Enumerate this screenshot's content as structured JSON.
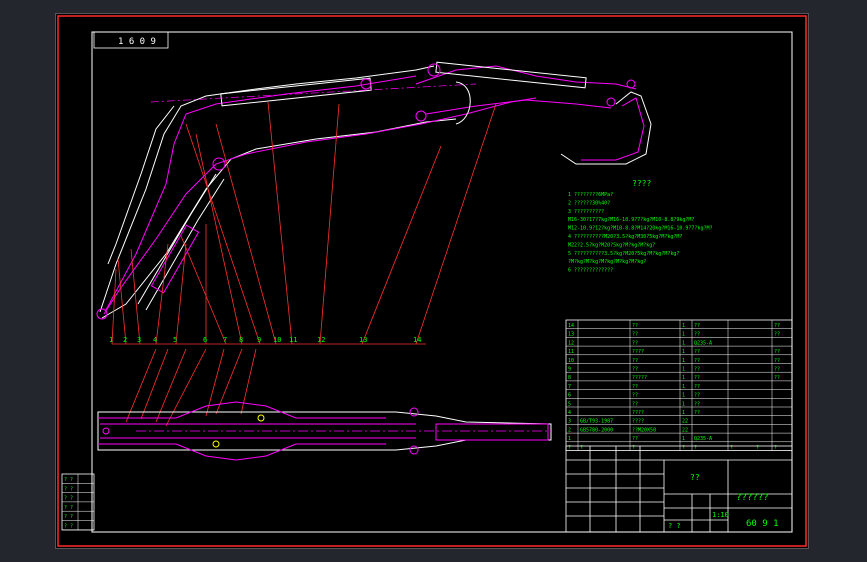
{
  "drawing": {
    "stamp_label": "1 6 0 9",
    "notes_heading": "????",
    "notes": [
      "1    ????????6MPa?",
      "2    ??????30%40?",
      "3    ??????????",
      "     M16-30?17?7kg?M16-10.9?7?kg?M10-8.8?9kg?M?",
      "     M12-10.9?12?kg?M10-8.8?M14?20kg?M16-10.9?7?kg?M?",
      "4    ??????????M20?3.5?kg?M30?5kg?M?kg?M?",
      "     M22?2.5?kg?M20?5kg?M?kg?M?kg?",
      "5    ??????????3.5?kg?M20?5kg?M?kg?M?kg?",
      "     ?M?kg?M?kg?M?kg?M?kg?M?kg?",
      "6    ?????????????"
    ],
    "balloons": [
      "1",
      "2",
      "3",
      "4",
      "5",
      "6",
      "7",
      "8",
      "9",
      "10",
      "11",
      "12",
      "13",
      "14"
    ],
    "bom_rows": [
      {
        "no": "14",
        "code": "",
        "name": "??",
        "qty": "1",
        "mat": "??",
        "note": "??"
      },
      {
        "no": "13",
        "code": "",
        "name": "??",
        "qty": "1",
        "mat": "??",
        "note": "??"
      },
      {
        "no": "12",
        "code": "",
        "name": "??",
        "qty": "1",
        "mat": "Q235-A",
        "note": ""
      },
      {
        "no": "11",
        "code": "",
        "name": "????",
        "qty": "1",
        "mat": "??",
        "note": "??"
      },
      {
        "no": "10",
        "code": "",
        "name": "??",
        "qty": "1",
        "mat": "??",
        "note": "??"
      },
      {
        "no": "9",
        "code": "",
        "name": "??",
        "qty": "1",
        "mat": "??",
        "note": "??"
      },
      {
        "no": "8",
        "code": "",
        "name": "?????",
        "qty": "1",
        "mat": "??",
        "note": "??"
      },
      {
        "no": "7",
        "code": "",
        "name": "??",
        "qty": "1",
        "mat": "??",
        "note": ""
      },
      {
        "no": "6",
        "code": "",
        "name": "??",
        "qty": "1",
        "mat": "??",
        "note": ""
      },
      {
        "no": "5",
        "code": "",
        "name": "??",
        "qty": "1",
        "mat": "??",
        "note": ""
      },
      {
        "no": "4",
        "code": "",
        "name": "????",
        "qty": "1",
        "mat": "??",
        "note": ""
      },
      {
        "no": "3",
        "code": "GB/T93-1987",
        "name": "????",
        "qty": "22",
        "mat": "",
        "note": ""
      },
      {
        "no": "2",
        "code": "GB5780-2000",
        "name": "??M20X50",
        "qty": "22",
        "mat": "",
        "note": ""
      },
      {
        "no": "1",
        "code": "",
        "name": "??",
        "qty": "1",
        "mat": "Q235-A",
        "note": ""
      }
    ],
    "bom_header": [
      "?",
      "?",
      "?",
      "?",
      "?",
      "?",
      "?",
      "?"
    ],
    "title_block": {
      "part_name": "??",
      "drawing_title": "??????",
      "drawing_no": "60 9 1",
      "scale_label": "1:10",
      "sheet_label": "? ?"
    },
    "side_table": [
      "? ?",
      "? ?",
      "? ?",
      "? ?",
      "? ?",
      "? ?"
    ]
  },
  "colors": {
    "frame": "#ff0000",
    "outline": "#ffffff",
    "part": "#ff00ff",
    "text": "#00ff00",
    "leader": "#ff3030"
  }
}
